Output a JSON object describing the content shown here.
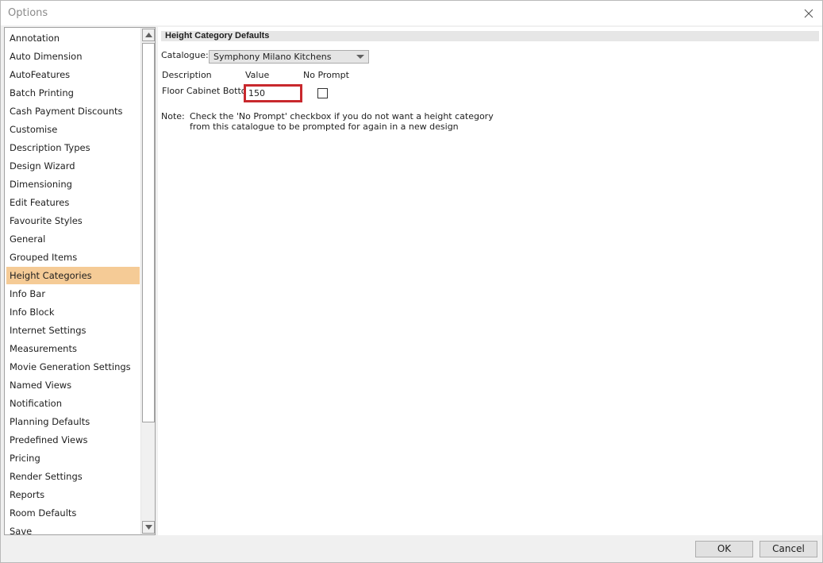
{
  "window": {
    "title": "Options"
  },
  "sidebar": {
    "items": [
      "Annotation",
      "Auto Dimension",
      "AutoFeatures",
      "Batch Printing",
      "Cash Payment Discounts",
      "Customise",
      "Description Types",
      "Design Wizard",
      "Dimensioning",
      "Edit Features",
      "Favourite Styles",
      "General",
      "Grouped Items",
      "Height Categories",
      "Info Bar",
      "Info Block",
      "Internet Settings",
      "Measurements",
      "Movie Generation Settings",
      "Named Views",
      "Notification",
      "Planning Defaults",
      "Predefined Views",
      "Pricing",
      "Render Settings",
      "Reports",
      "Room Defaults",
      "Save"
    ],
    "selected": "Height Categories"
  },
  "content": {
    "header": "Height Category Defaults",
    "catalogue_label": "Catalogue:",
    "catalogue_value": "Symphony Milano Kitchens",
    "columns": {
      "description": "Description",
      "value": "Value",
      "no_prompt": "No Prompt"
    },
    "row": {
      "description": "Floor Cabinet Bottom",
      "value": "150",
      "no_prompt": false
    },
    "note_label": "Note:",
    "note_line1": "Check the 'No Prompt' checkbox if you do not want a height category",
    "note_line2": "from this catalogue to be prompted for again in a new design"
  },
  "buttons": {
    "ok": "OK",
    "cancel": "Cancel"
  },
  "colors": {
    "selection": "#f5cb96",
    "highlight_border": "#c8282d"
  }
}
